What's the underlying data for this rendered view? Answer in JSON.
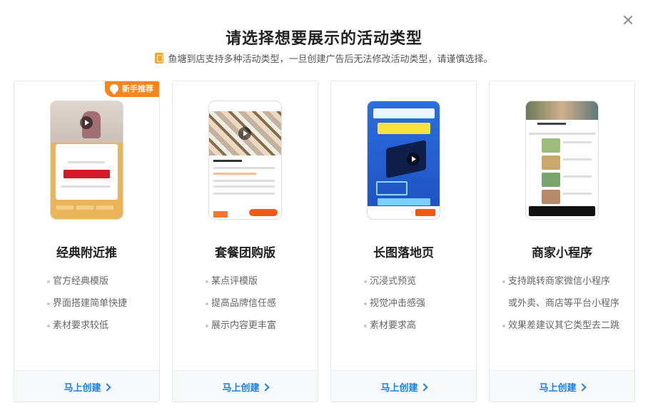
{
  "header": {
    "title": "请选择想要展示的活动类型",
    "subtitle": "鱼塘到店支持多种活动类型，一旦创建广告后无法修改活动类型，请谨慎选择。"
  },
  "icons": {
    "close": "close-icon",
    "tip": "document-tip-icon",
    "badge": "lightbulb-icon",
    "chevron": "chevron-right-icon"
  },
  "colors": {
    "accent_blue": "#1a7fe8",
    "badge_orange": "#f7851b"
  },
  "cards": [
    {
      "title": "经典附近推",
      "badge": "新手推荐",
      "features": [
        "官方经典模版",
        "界面搭建简单快捷",
        "素材要求较低"
      ],
      "action": "马上创建"
    },
    {
      "title": "套餐团购版",
      "features": [
        "某点评模版",
        "提高品牌信任感",
        "展示内容更丰富"
      ],
      "action": "马上创建"
    },
    {
      "title": "长图落地页",
      "features": [
        "沉浸式预览",
        "视觉冲击感强",
        "素材要求高"
      ],
      "action": "马上创建"
    },
    {
      "title": "商家小程序",
      "features": [
        "支持跳转商家微信小程序",
        "或外卖、商店等平台小程序",
        "效果差建议其它类型去二跳"
      ],
      "action": "马上创建"
    }
  ]
}
